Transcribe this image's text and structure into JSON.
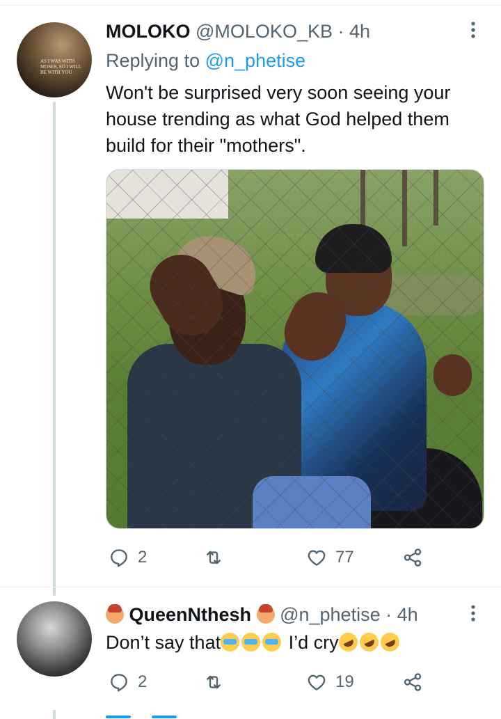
{
  "tweets": [
    {
      "name": "MOLOKO",
      "handle": "@MOLOKO_KB",
      "separator": "·",
      "time": "4h",
      "replying_prefix": "Replying to",
      "replying_to": "@n_phetise",
      "text": "Won't be surprised very soon seeing your house trending as what God helped them build for their \"mothers\".",
      "avatar_caption": "AS I WAS WITH MOSES, SO I WILL BE WITH YOU",
      "media_icon": "photo",
      "replies": "2",
      "retweets": "",
      "likes": "77"
    },
    {
      "name": "QueenNthesh",
      "handle": "@n_phetise",
      "separator": "·",
      "time": "4h",
      "text_parts": [
        "Don’t say that",
        "I’d cry"
      ],
      "replies": "2",
      "retweets": "",
      "likes": "19"
    }
  ],
  "icons": {
    "more": "more-vertical-icon",
    "reply": "reply-icon",
    "retweet": "retweet-icon",
    "like": "heart-icon",
    "share": "share-icon"
  },
  "colors": {
    "text": "#0f1419",
    "secondary": "#536471",
    "accent": "#1d9bf0",
    "thread_line": "#cfd9de"
  }
}
